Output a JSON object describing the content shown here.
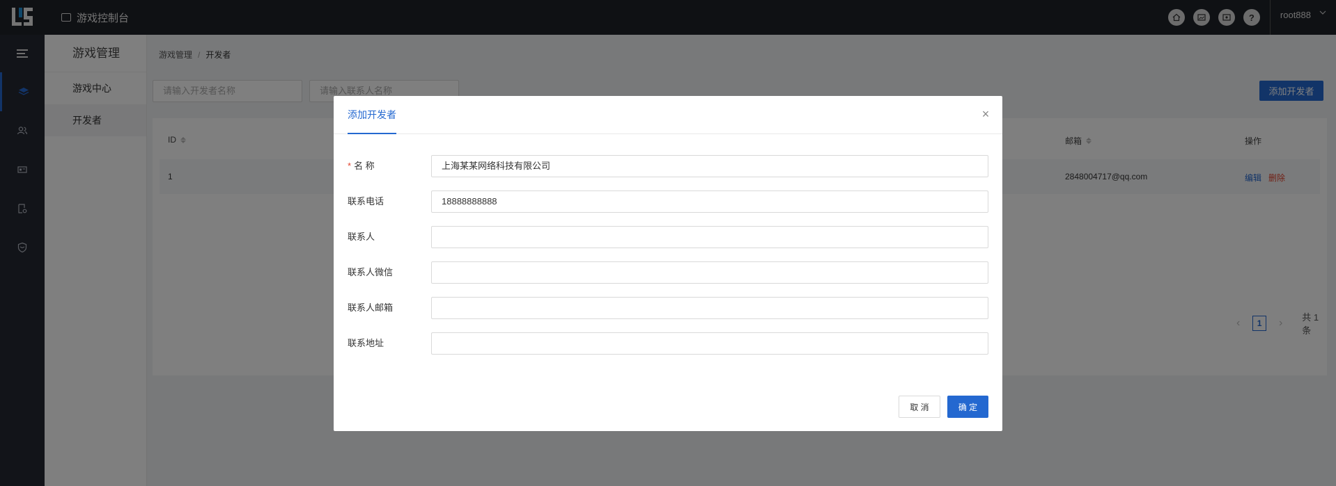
{
  "topbar": {
    "app_title": "游戏控制台",
    "icons": [
      "home-icon",
      "image-icon",
      "image-icon",
      "help-icon"
    ],
    "help_glyph": "?",
    "user": "root888"
  },
  "icon_sidebar": [
    "menu-icon",
    "layers-icon",
    "users-icon",
    "card-icon",
    "doc-settings-icon",
    "shield-icon"
  ],
  "sub_sidebar": {
    "title": "游戏管理",
    "items": [
      {
        "label": "游戏中心",
        "active": false
      },
      {
        "label": "开发者",
        "active": true
      }
    ]
  },
  "breadcrumb": {
    "parent": "游戏管理",
    "sep": "/",
    "current": "开发者"
  },
  "filters": {
    "dev_name_placeholder": "请输入开发者名称",
    "contact_name_placeholder": "请输入联系人名称"
  },
  "add_button": "添加开发者",
  "table": {
    "headers": {
      "id": "ID",
      "email": "邮箱",
      "actions": "操作"
    },
    "rows": [
      {
        "id": "1",
        "email": "2848004717@qq.com",
        "edit": "编辑",
        "delete": "删除"
      }
    ]
  },
  "pagination": {
    "prev": "‹",
    "page": "1",
    "next": "›",
    "total": "共 1 条"
  },
  "modal": {
    "title": "添加开发者",
    "close": "×",
    "fields": [
      {
        "label": "名 称",
        "required": true,
        "value": "上海某某网络科技有限公司"
      },
      {
        "label": "联系电话",
        "required": false,
        "value": "18888888888"
      },
      {
        "label": "联系人",
        "required": false,
        "value": ""
      },
      {
        "label": "联系人微信",
        "required": false,
        "value": ""
      },
      {
        "label": "联系人邮箱",
        "required": false,
        "value": ""
      },
      {
        "label": "联系地址",
        "required": false,
        "value": ""
      }
    ],
    "required_mark": "*",
    "cancel": "取 消",
    "confirm": "确 定"
  },
  "colors": {
    "primary": "#2468d0",
    "danger": "#e3452f",
    "topbar": "#1f2229",
    "sidebar": "#252932"
  }
}
